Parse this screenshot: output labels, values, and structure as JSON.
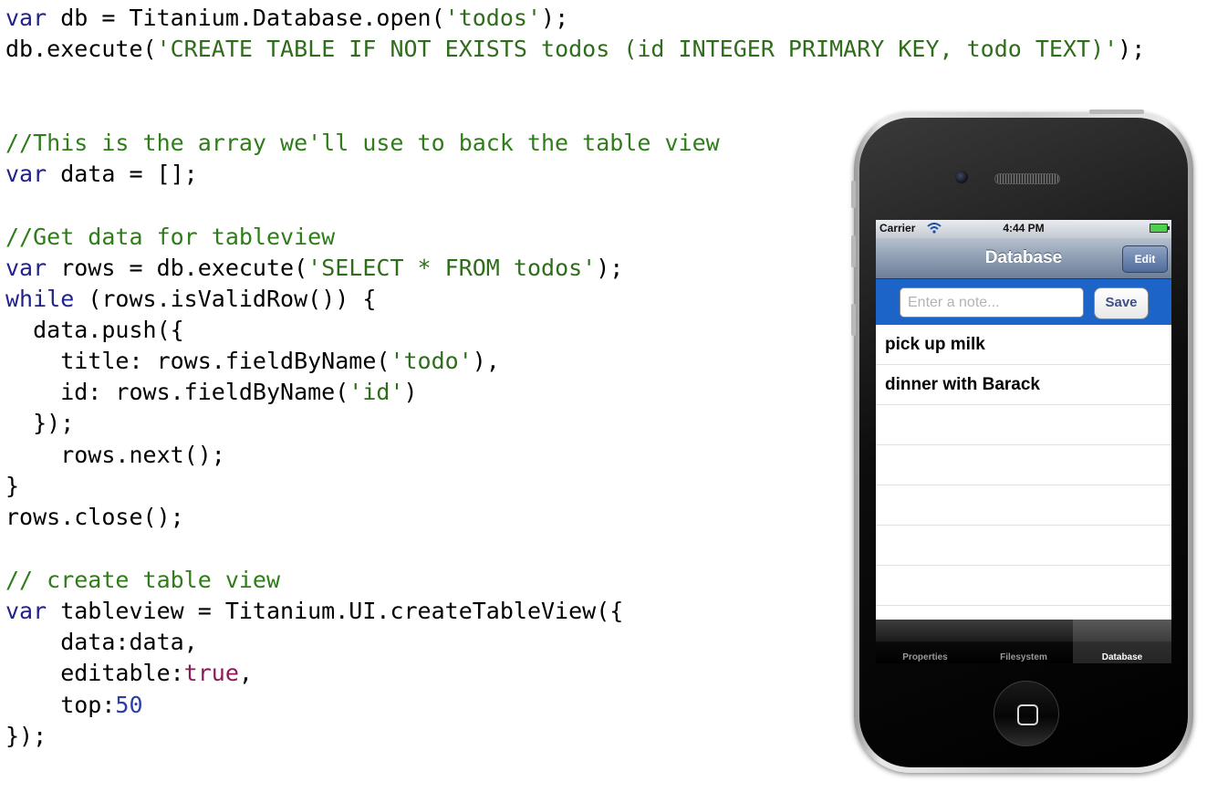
{
  "code_lines": [
    "var db = Titanium.Database.open('todos');",
    "db.execute('CREATE TABLE IF NOT EXISTS todos (id INTEGER PRIMARY KEY, todo TEXT)');",
    "//This is the array we'll use to back the table view",
    "var data = [];",
    "//Get data for tableview",
    "var rows = db.execute('SELECT * FROM todos');",
    "while (rows.isValidRow()) {",
    "  data.push({",
    "    title: rows.fieldByName('todo'),",
    "    id: rows.fieldByName('id')",
    "  });",
    "    rows.next();",
    "}",
    "rows.close();",
    "// create table view",
    "var tableview = Titanium.UI.createTableView({",
    "    data:data,",
    "    editable:true,",
    "    top:50",
    "});"
  ],
  "code_tokens": {
    "var": "var",
    "while": "while",
    "l1_rest": " db = Titanium.Database.open(",
    "l1_str": "'todos'",
    "l1_end": ");",
    "l2_a": "db.execute(",
    "l2_str": "'CREATE TABLE IF NOT EXISTS todos (id INTEGER PRIMARY KEY, todo TEXT)'",
    "l2_end": ");",
    "l3_comment": "//This is the array we'll use to back the table view",
    "l4_rest": " data = [];",
    "l5_comment": "//Get data for tableview",
    "l6_rest": " rows = db.execute(",
    "l6_str": "'SELECT * FROM todos'",
    "l6_end": ");",
    "l7_rest": " (rows.isValidRow()) {",
    "l8": "  data.push({",
    "l9_a": "    title: rows.fieldByName(",
    "l9_str": "'todo'",
    "l9_end": "),",
    "l10_a": "    id: rows.fieldByName(",
    "l10_str": "'id'",
    "l10_end": ")",
    "l11": "  });",
    "l12": "    rows.next();",
    "l13": "}",
    "l14": "rows.close();",
    "l15_comment": "// create table view",
    "l16_rest": " tableview = Titanium.UI.createTableView({",
    "l17": "    data:data,",
    "l18_a": "    editable:",
    "l18_bool": "true",
    "l18_end": ",",
    "l19_a": "    top:",
    "l19_num": "50",
    "l20": "});"
  },
  "phone": {
    "status": {
      "carrier": "Carrier",
      "time": "4:44 PM"
    },
    "navbar": {
      "title": "Database",
      "edit_label": "Edit"
    },
    "input": {
      "placeholder": "Enter a note...",
      "save_label": "Save"
    },
    "rows": [
      "pick up milk",
      "dinner with Barack",
      "",
      "",
      "",
      "",
      ""
    ],
    "tabs": [
      {
        "label": "Properties",
        "active": false
      },
      {
        "label": "Filesystem",
        "active": false
      },
      {
        "label": "Database",
        "active": true
      }
    ]
  },
  "colors": {
    "keyword": "#22228c",
    "string": "#2f6d1c",
    "comment": "#2e7d19",
    "boolean": "#8c1a5a",
    "number": "#2a3ea8",
    "input_bar": "#1c64c8"
  },
  "icons": [
    "wifi-icon",
    "battery-icon",
    "camera-icon",
    "speaker-icon",
    "home-button-icon"
  ]
}
